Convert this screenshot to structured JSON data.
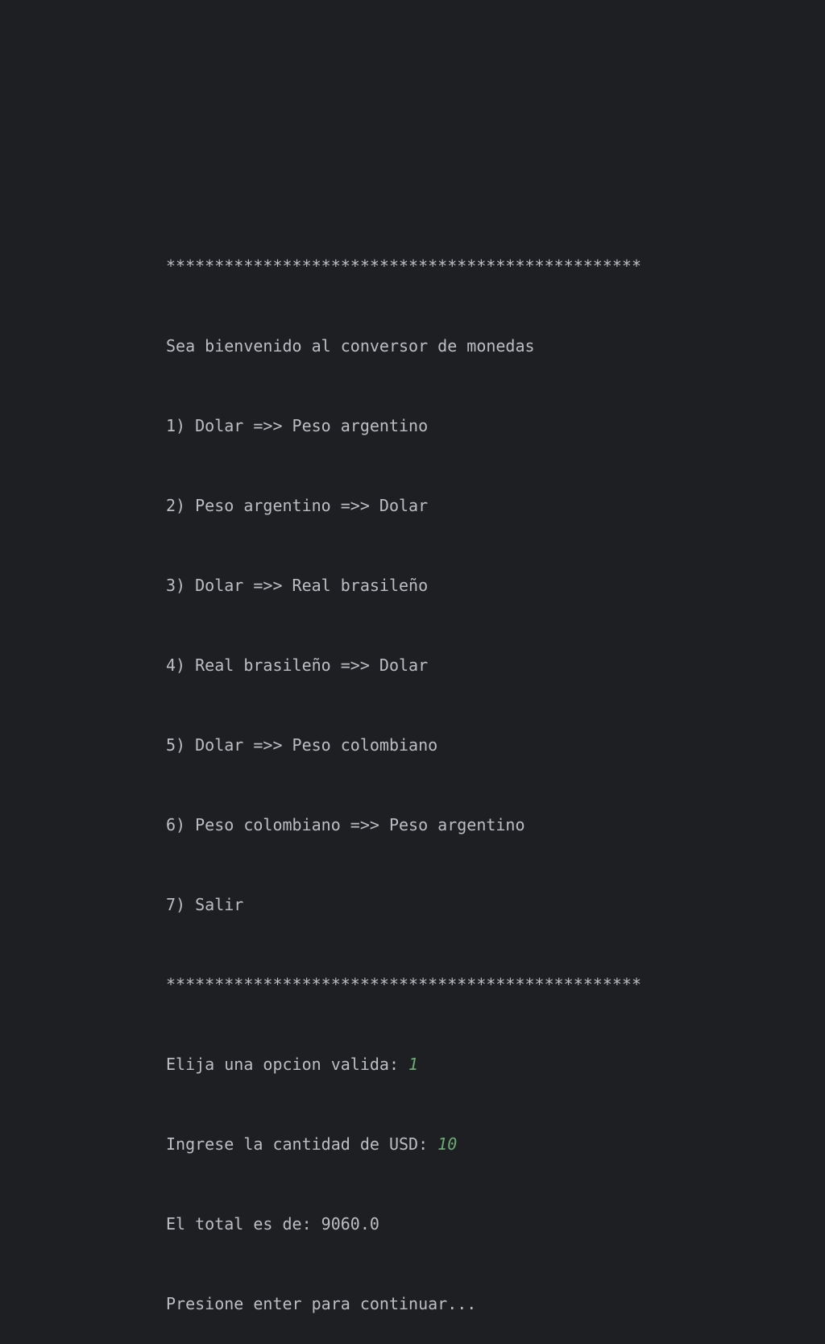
{
  "console": {
    "separator_top": "*************************************************",
    "welcome": "Sea bienvenido al conversor de monedas",
    "menu": [
      "1) Dolar =>> Peso argentino",
      "2) Peso argentino =>> Dolar",
      "3) Dolar =>> Real brasileño",
      "4) Real brasileño =>> Dolar",
      "5) Dolar =>> Peso colombiano",
      "6) Peso colombiano =>> Peso argentino",
      "7) Salir"
    ],
    "separator_bottom": "*************************************************",
    "prompt_option": "Elija una opcion valida: ",
    "input_option": "1",
    "prompt_amount": "Ingrese la cantidad de USD: ",
    "input_amount": "10",
    "result": "El total es de: 9060.0",
    "continue_prompt": "Presione enter para continuar..."
  },
  "colors": {
    "background": "#1e1f22",
    "text": "#bcbec4",
    "user_input": "#6aab73"
  }
}
